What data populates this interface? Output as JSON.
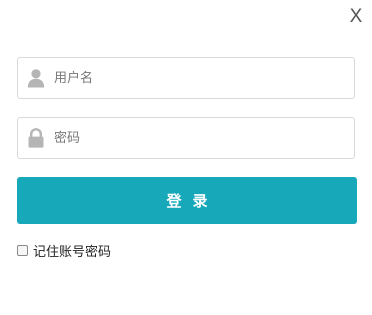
{
  "dialog": {
    "close_label": "X"
  },
  "form": {
    "username": {
      "placeholder": "用户名",
      "value": "",
      "icon": "user-icon"
    },
    "password": {
      "placeholder": "密码",
      "value": "",
      "icon": "lock-icon"
    },
    "submit_label": "登录",
    "remember_label": "记住账号密码",
    "remember_checked": false
  },
  "colors": {
    "accent": "#17a8b9",
    "field_border": "#d9d9d9",
    "icon": "#b5b5b5"
  }
}
